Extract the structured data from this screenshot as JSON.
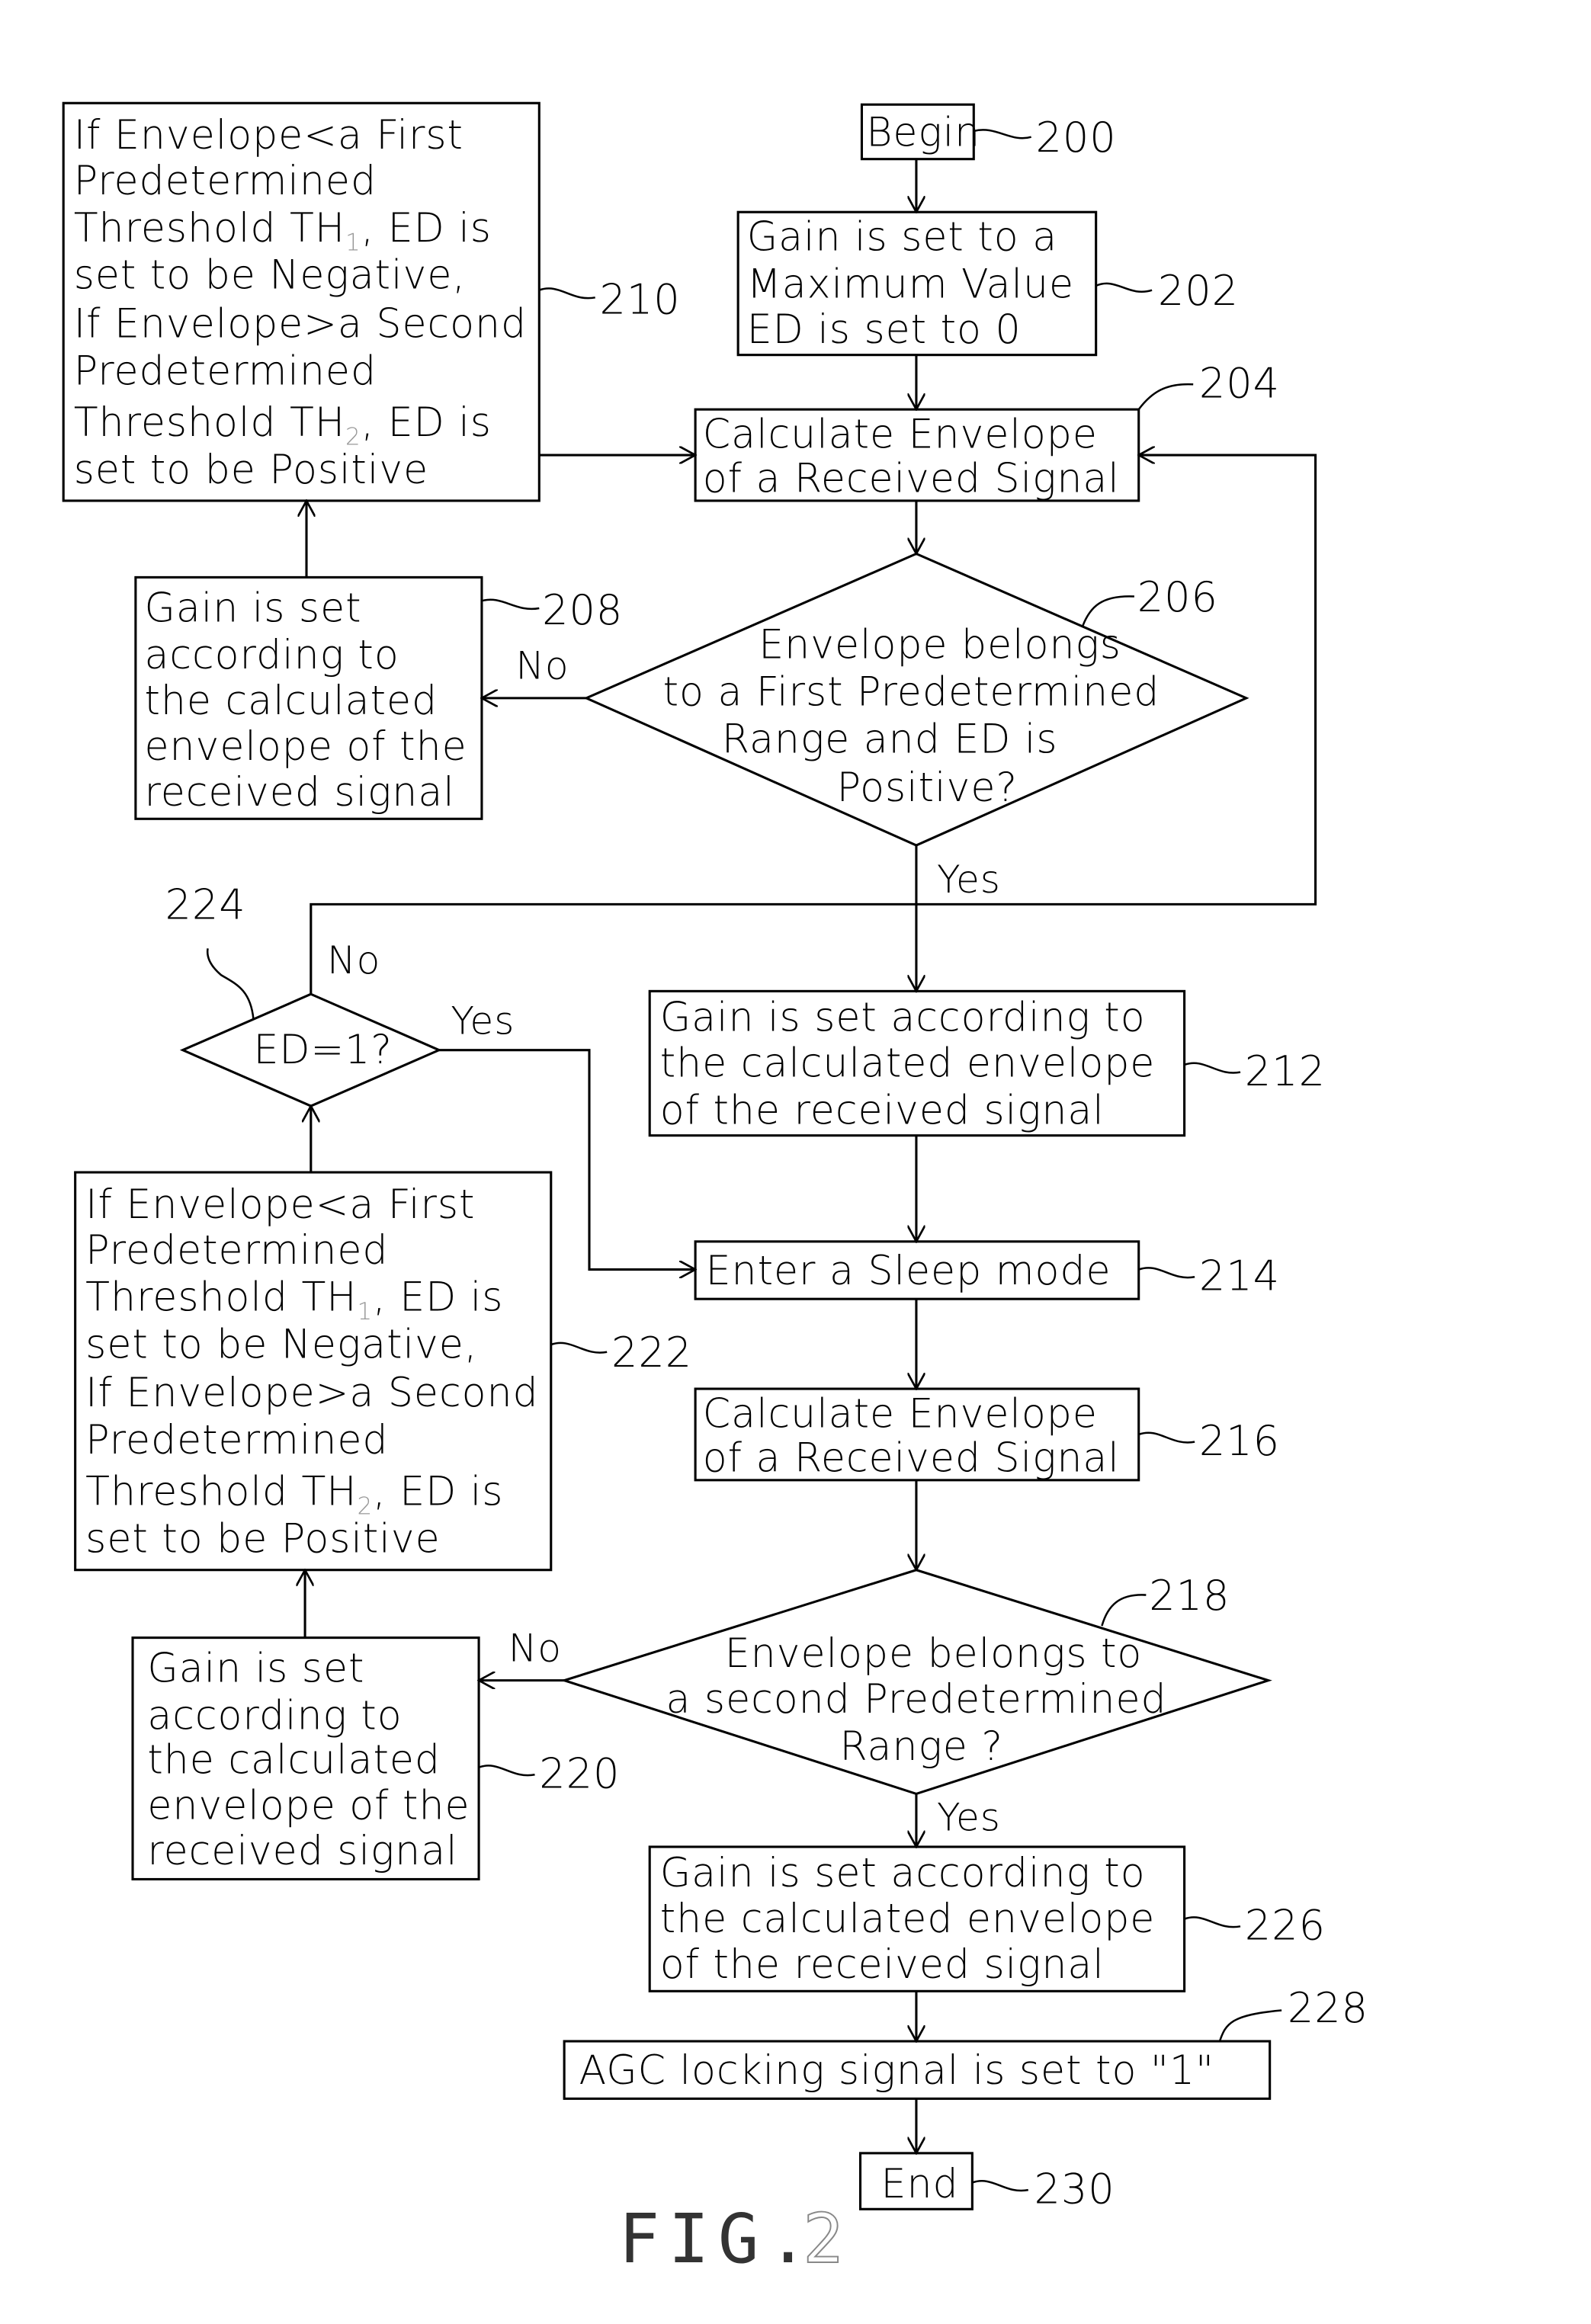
{
  "figure": {
    "caption_prefix": "FIG.",
    "caption_number": "2"
  },
  "nodes": {
    "begin": {
      "ref": "200",
      "lines": [
        "Begin"
      ]
    },
    "init": {
      "ref": "202",
      "lines": [
        "Gain is set to a",
        "Maximum Value",
        "ED is set to 0"
      ]
    },
    "calc1": {
      "ref": "204",
      "lines": [
        "Calculate Envelope",
        "of a Received Signal"
      ]
    },
    "decision1": {
      "ref": "206",
      "lines": [
        "Envelope belongs",
        "to a First Predetermined",
        "Range and ED is",
        "Positive?"
      ]
    },
    "gain1": {
      "ref": "208",
      "lines": [
        "Gain is set",
        "according to",
        "the calculated",
        "envelope of the",
        "received signal"
      ]
    },
    "ed1": {
      "ref": "210",
      "lines": [
        "If Envelope<a First",
        "Predetermined",
        "Threshold TH",
        ", ED is",
        "set to be Negative,",
        "If Envelope>a Second",
        "Predetermined",
        "Threshold TH",
        ", ED is",
        "set to be Positive"
      ],
      "sub1": "1",
      "sub2": "2"
    },
    "gain2": {
      "ref": "212",
      "lines": [
        "Gain is set according to",
        "the calculated envelope",
        "of the received signal"
      ]
    },
    "sleep": {
      "ref": "214",
      "lines": [
        "Enter a Sleep mode"
      ]
    },
    "calc2": {
      "ref": "216",
      "lines": [
        "Calculate Envelope",
        "of a Received Signal"
      ]
    },
    "decision2": {
      "ref": "218",
      "lines": [
        "Envelope belongs to",
        "a second Predetermined",
        "Range ?"
      ]
    },
    "gain3": {
      "ref": "220",
      "lines": [
        "Gain is set",
        "according to",
        "the calculated",
        "envelope of the",
        "received signal"
      ]
    },
    "ed2": {
      "ref": "222",
      "lines": [
        "If Envelope<a First",
        "Predetermined",
        "Threshold TH",
        ", ED is",
        "set to be Negative,",
        "If Envelope>a Second",
        "Predetermined",
        "Threshold TH",
        ", ED is",
        "set to be Positive"
      ],
      "sub1": "1",
      "sub2": "2"
    },
    "decision3": {
      "ref": "224",
      "lines": [
        "ED=1?"
      ]
    },
    "gain4": {
      "ref": "226",
      "lines": [
        "Gain is set according to",
        "the calculated envelope",
        "of the received signal"
      ]
    },
    "agc": {
      "ref": "228",
      "lines": [
        "AGC locking signal is set to \"1\""
      ]
    },
    "end": {
      "ref": "230",
      "lines": [
        "End"
      ]
    }
  },
  "edge_labels": {
    "d1_no": "No",
    "d1_yes": "Yes",
    "d2_no": "No",
    "d2_yes": "Yes",
    "d3_no": "No",
    "d3_yes": "Yes"
  }
}
